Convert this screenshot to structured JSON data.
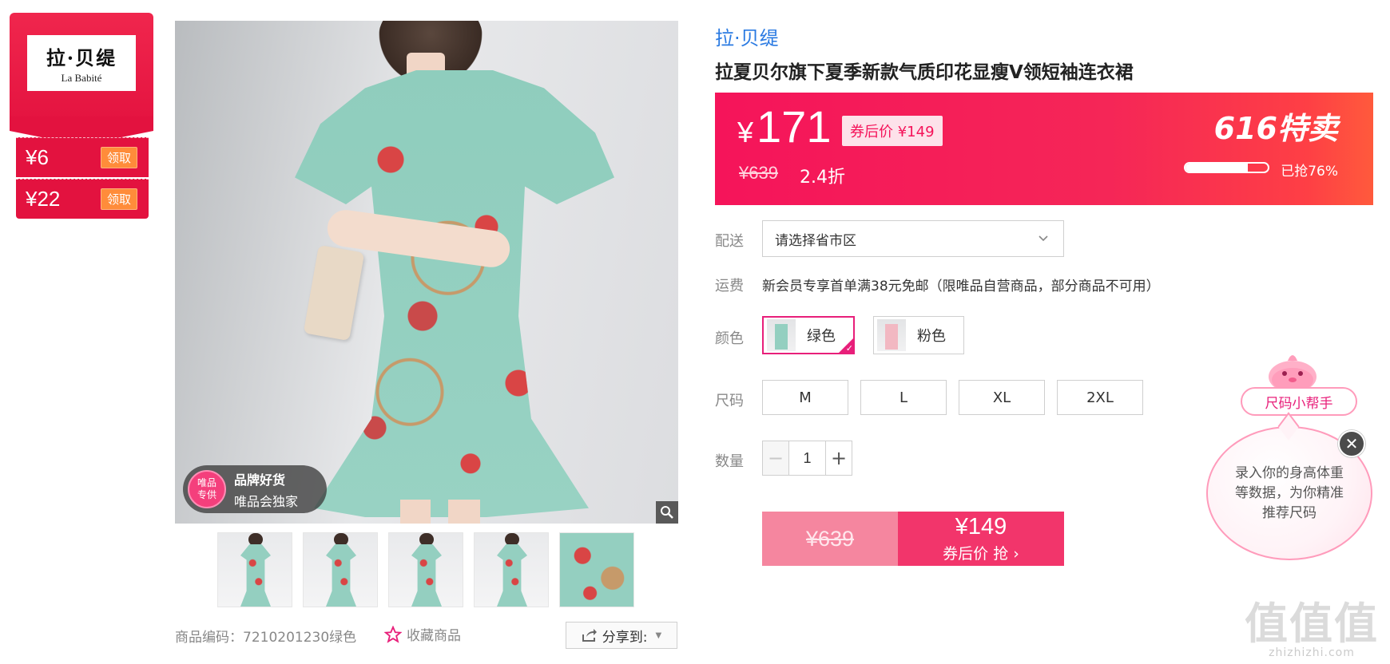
{
  "brand": {
    "logo_cn": "拉·贝缇",
    "logo_en": "La Babité",
    "coupons": [
      {
        "amount": "¥6",
        "button": "领取"
      },
      {
        "amount": "¥22",
        "button": "领取"
      }
    ]
  },
  "gallery": {
    "badge_circle": "唯品\n专供",
    "badge_line1": "品牌好货",
    "badge_line2": "唯品会独家",
    "zoom_icon": "search-icon",
    "thumbnails": 5,
    "product_code": "商品编码：7210201230绿色",
    "favorite_label": "收藏商品",
    "share_label": "分享到:"
  },
  "product": {
    "brand_link": "拉·贝缇",
    "title": "拉夏贝尔旗下夏季新款气质印花显瘦V领短袖连衣裙"
  },
  "price": {
    "currency": "¥",
    "current": "171",
    "coupon_price": "券后价 ¥149",
    "original": "¥639",
    "discount": "2.4折",
    "promo_title": "616特卖",
    "sold_percent": 76,
    "sold_text": "已抢76%",
    "colors": {
      "gradient_start": "#f5145a",
      "gradient_end": "#ff5a3c"
    }
  },
  "options": {
    "delivery_label": "配送",
    "region_placeholder": "请选择省市区",
    "shipping_label": "运费",
    "shipping_text": "新会员专享首单满38元免邮（限唯品自营商品，部分商品不可用）",
    "color_label": "颜色",
    "colors": [
      {
        "name": "绿色",
        "selected": true
      },
      {
        "name": "粉色",
        "selected": false
      }
    ],
    "size_label": "尺码",
    "sizes": [
      "M",
      "L",
      "XL",
      "2XL"
    ],
    "quantity_label": "数量",
    "quantity": "1"
  },
  "buy": {
    "original": "¥639",
    "price": "¥149",
    "label": "券后价 抢 ›"
  },
  "size_helper": {
    "pill": "尺码小帮手",
    "bubble_text": "录入你的身高体重等数据，为你精准推荐尺码",
    "close_icon": "close-icon"
  },
  "watermark": {
    "big": "值值值",
    "small": "zhizhizhi.com"
  }
}
